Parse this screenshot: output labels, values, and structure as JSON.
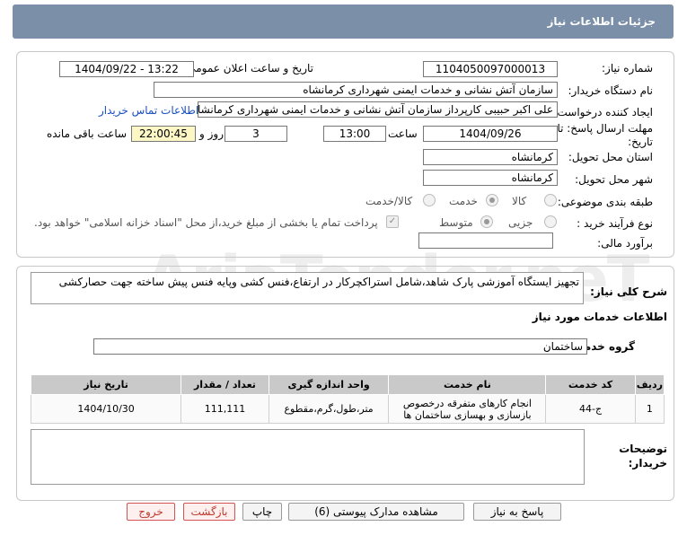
{
  "header": {
    "title": "جزئیات اطلاعات نیاز"
  },
  "form": {
    "need_number_label": "شماره نیاز:",
    "need_number": "1104050097000013",
    "announce_label": "تاریخ و ساعت اعلان عمومی:",
    "announce_value": "1404/09/22 - 13:22",
    "buyer_org_label": "نام دستگاه خریدار:",
    "buyer_org": "سازمان آتش نشانی و خدمات ایمنی شهرداری کرمانشاه",
    "creator_label": "ایجاد کننده درخواست:",
    "creator": "علی اکبر حبیبی کارپرداز سازمان آتش نشانی و خدمات ایمنی شهرداری کرمانشاه",
    "contact_link": "اطلاعات تماس خریدار",
    "deadline_label": "مهلت ارسال پاسخ: تا تاریخ:",
    "deadline_date": "1404/09/26",
    "time_label": "ساعت",
    "deadline_time": "13:00",
    "days_value": "3",
    "days_label": "روز و",
    "remaining_time": "22:00:45",
    "remaining_label": "ساعت باقی مانده",
    "province_label": "استان محل تحویل:",
    "province": "کرمانشاه",
    "city_label": "شهر محل تحویل:",
    "city": "کرمانشاه",
    "category_label": "طبقه بندی موضوعی:",
    "category_goods": "کالا",
    "category_service": "خدمت",
    "category_both": "کالا/خدمت",
    "process_label": "نوع فرآیند خرید :",
    "process_minor": "جزیی",
    "process_medium": "متوسط",
    "payment_note": "پرداخت تمام یا بخشی از مبلغ خرید،از محل \"اسناد خزانه اسلامی\" خواهد بود.",
    "estimate_label": "برآورد مالی:",
    "estimate_value": ""
  },
  "description": {
    "label": "شرح کلی نیاز:",
    "text": "تجهیز ایستگاه آموزشی پارک شاهد،شامل استراکچرکار در ارتفاع،فنس کشی وپایه فنس پیش ساخته جهت حصارکشی"
  },
  "services": {
    "section_title": "اطلاعات خدمات مورد نیاز",
    "group_label": "گروه خدمت:",
    "group_value": "ساختمان",
    "columns": [
      "ردیف",
      "کد خدمت",
      "نام خدمت",
      "واحد اندازه گیری",
      "تعداد / مقدار",
      "تاریخ نیاز"
    ],
    "rows": [
      {
        "row": "1",
        "code": "ج-44",
        "name": "انجام کارهای متفرقه درخصوص بازسازی و بهسازی ساختمان ها",
        "unit": "متر،طول،گرم،مقطوع",
        "qty": "111,111",
        "date": "1404/10/30"
      }
    ]
  },
  "buyer_notes": {
    "label": "توضیحات خریدار:",
    "value": ""
  },
  "watermark": "AriaTender.neT",
  "buttons": {
    "reply": "پاسخ به نیاز",
    "attachments": "مشاهده مدارک پیوستی (6)",
    "print": "چاپ",
    "back": "بازگشت",
    "exit": "خروج"
  }
}
